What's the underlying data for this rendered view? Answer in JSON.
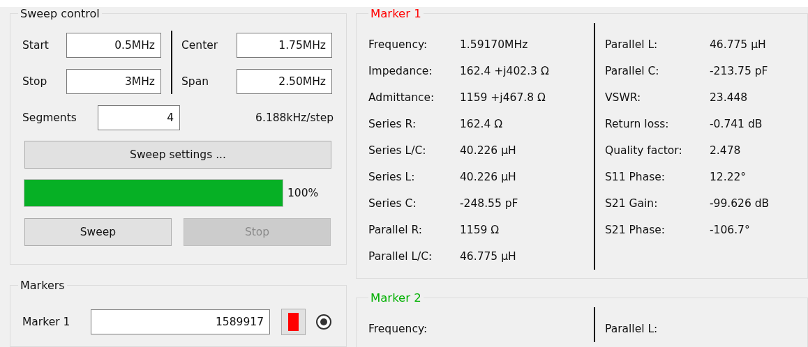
{
  "sweep_control": {
    "title": "Sweep control",
    "fields_left": [
      {
        "label": "Start",
        "value": "0.5MHz"
      },
      {
        "label": "Stop",
        "value": "3MHz"
      }
    ],
    "fields_right": [
      {
        "label": "Center",
        "value": "1.75MHz"
      },
      {
        "label": "Span",
        "value": "2.50MHz"
      }
    ],
    "segments": {
      "label": "Segments",
      "value": "4"
    },
    "step": "6.188kHz/step",
    "settings_button": "Sweep settings ...",
    "progress": {
      "level": 1.0,
      "reading": "100%"
    },
    "buttons": [
      {
        "label": "Sweep",
        "disabled": false
      },
      {
        "label": "Stop",
        "disabled": true
      }
    ]
  },
  "markers": {
    "title": "Markers",
    "items": [
      {
        "label": "Marker 1",
        "value": "1589917",
        "color": "#ff0000",
        "selected": true
      }
    ]
  },
  "marker_panels": [
    {
      "title": "Marker 1",
      "color": "#ff0000",
      "left": [
        {
          "label": "Frequency:",
          "value": "1.59170MHz"
        },
        {
          "label": "Impedance:",
          "value": "162.4 +j402.3 Ω"
        },
        {
          "label": "Admittance:",
          "value": "1159 +j467.8 Ω"
        },
        {
          "label": "Series R:",
          "value": "162.4 Ω"
        },
        {
          "label": "Series L/C:",
          "value": "40.226 µH"
        },
        {
          "label": "Series L:",
          "value": "40.226 µH"
        },
        {
          "label": "Series C:",
          "value": "-248.55 pF"
        },
        {
          "label": "Parallel R:",
          "value": "1159 Ω"
        },
        {
          "label": "Parallel L/C:",
          "value": "46.775 µH"
        }
      ],
      "right": [
        {
          "label": "Parallel L:",
          "value": "46.775 µH"
        },
        {
          "label": "Parallel C:",
          "value": "-213.75 pF"
        },
        {
          "label": "VSWR:",
          "value": "23.448"
        },
        {
          "label": "Return loss:",
          "value": "-0.741 dB"
        },
        {
          "label": "Quality factor:",
          "value": "2.478"
        },
        {
          "label": "S11 Phase:",
          "value": "12.22°"
        },
        {
          "label": "S21 Gain:",
          "value": "-99.626 dB"
        },
        {
          "label": "S21 Phase:",
          "value": "-106.7°"
        }
      ]
    },
    {
      "title": "Marker 2",
      "color": "#00b000",
      "left": [
        {
          "label": "Frequency:"
        }
      ],
      "right": [
        {
          "label": "Parallel L:"
        }
      ]
    }
  ]
}
